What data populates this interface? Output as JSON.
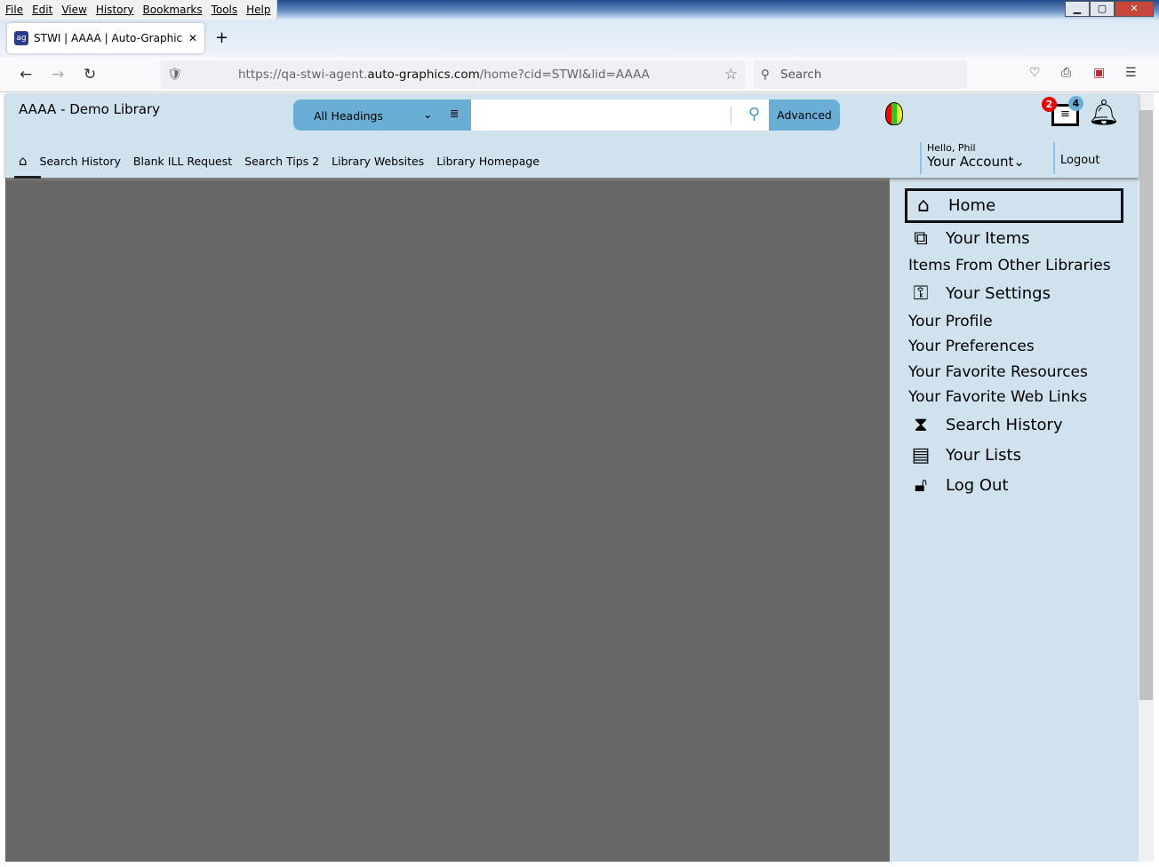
{
  "browser": {
    "menu": [
      "File",
      "Edit",
      "View",
      "History",
      "Bookmarks",
      "Tools",
      "Help"
    ],
    "tab_title": "STWI | AAAA | Auto-Graphics In",
    "url_prefix": "https://qa-stwi-agent.",
    "url_domain": "auto-graphics.com",
    "url_suffix": "/home?cid=STWI&lid=AAAA",
    "search_placeholder": "Search"
  },
  "header": {
    "library_name": "AAAA - Demo Library",
    "search_type": "All Headings",
    "advanced_label": "Advanced",
    "search_value": "",
    "list_badge": "2",
    "list_badge2": "4",
    "greeting": "Hello, Phil",
    "account_label": "Your Account",
    "logout_label": "Logout"
  },
  "nav": [
    "Search History",
    "Blank ILL Request",
    "Search Tips 2",
    "Library Websites",
    "Library Homepage"
  ],
  "sidebar": {
    "home": "Home",
    "your_items": "Your Items",
    "items_other": "Items From Other Libraries",
    "your_settings": "Your Settings",
    "profile": "Your Profile",
    "preferences": "Your Preferences",
    "fav_resources": "Your Favorite Resources",
    "fav_links": "Your Favorite Web Links",
    "search_history": "Search History",
    "your_lists": "Your Lists",
    "log_out": "Log Out"
  }
}
